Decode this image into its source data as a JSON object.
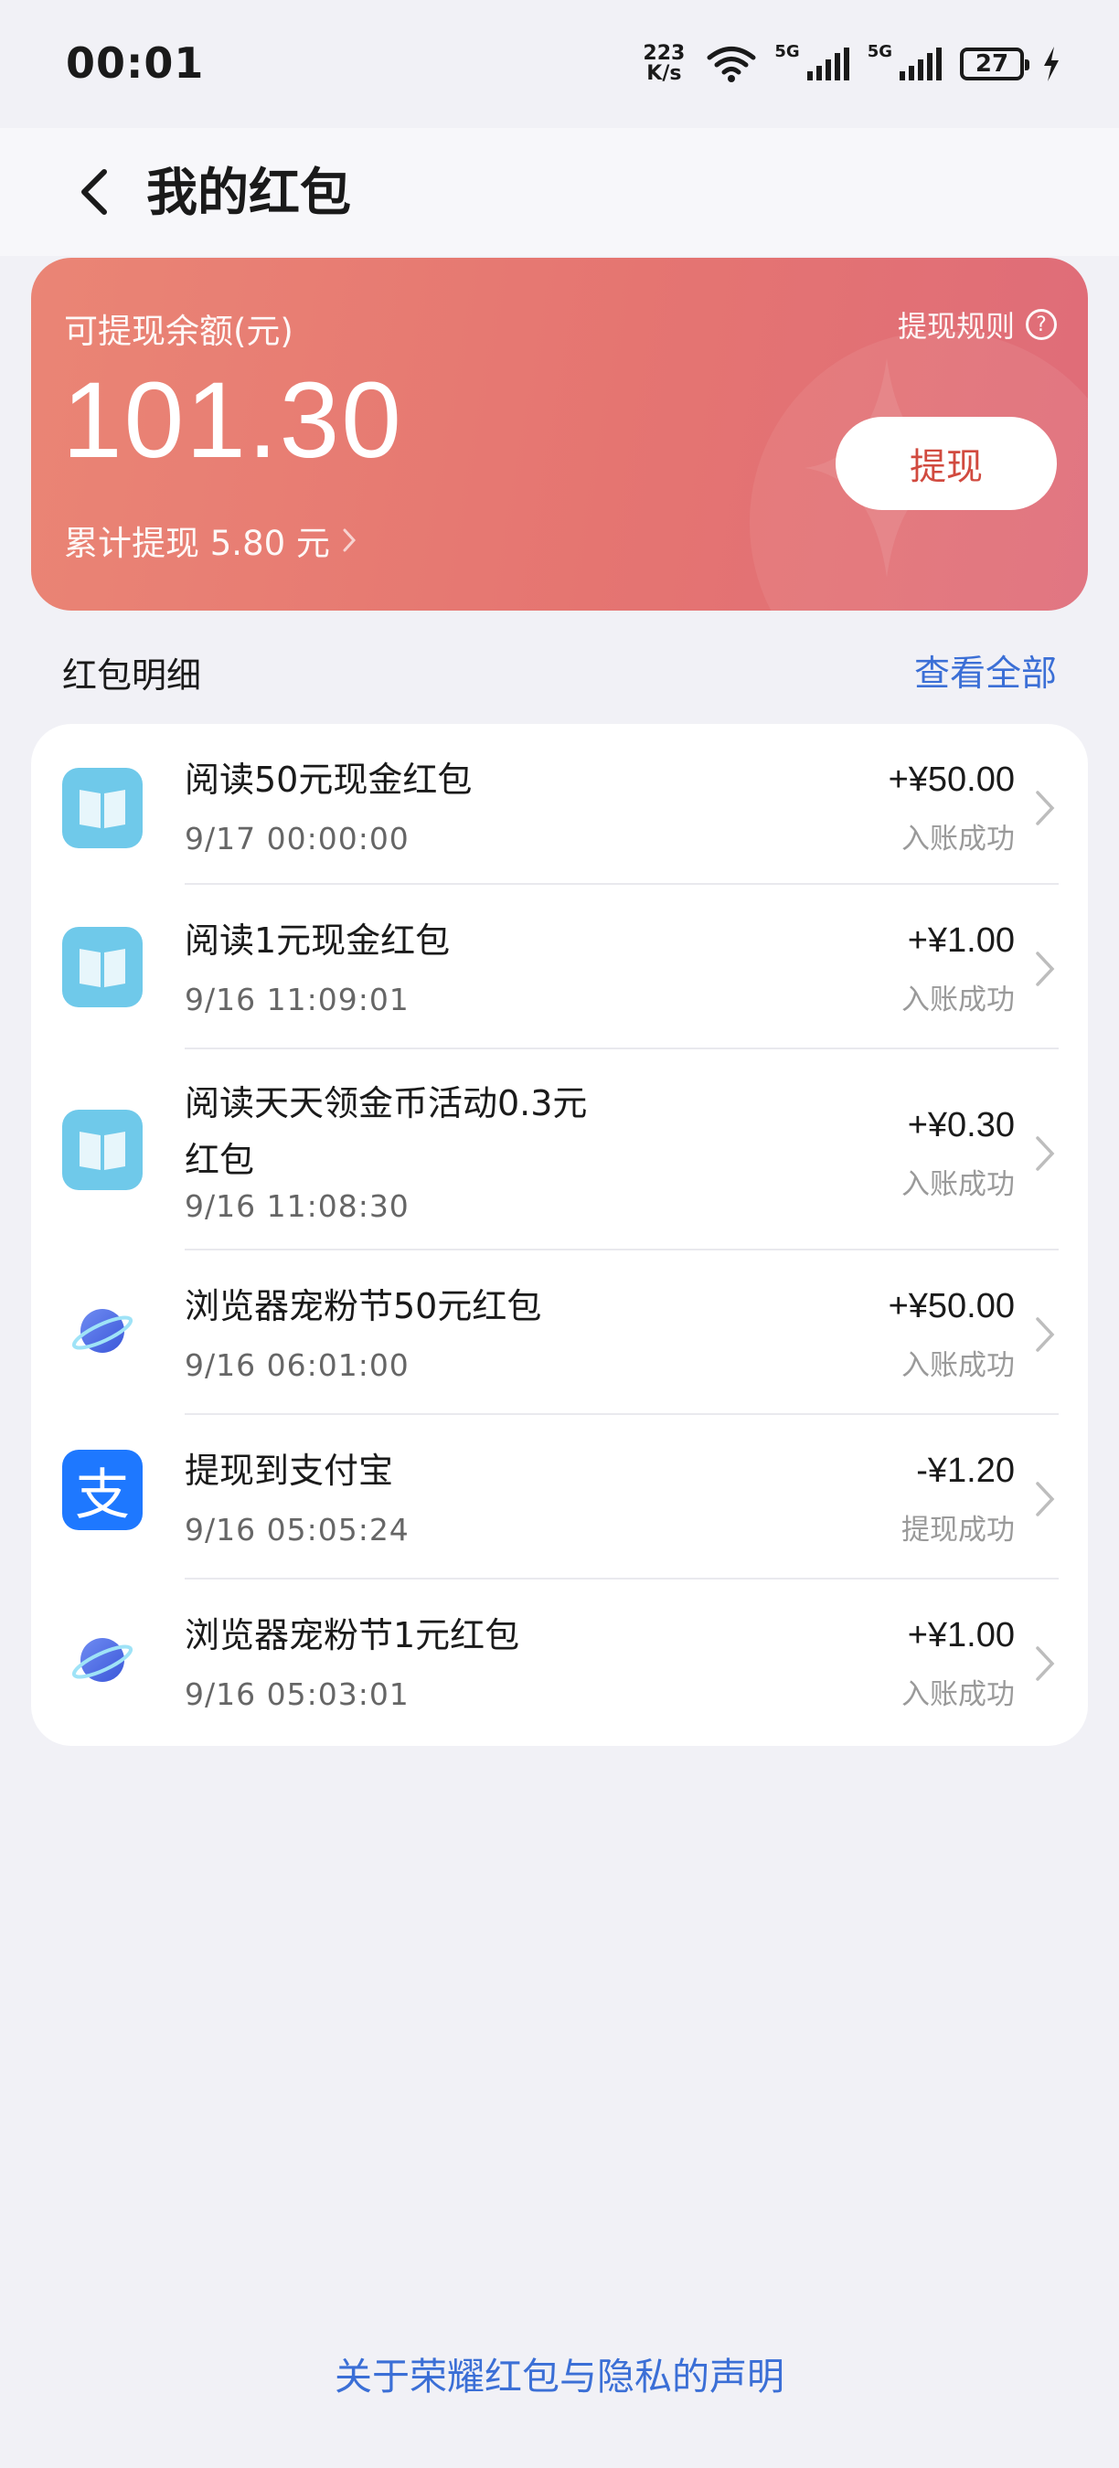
{
  "status_bar": {
    "time": "00:01",
    "speed_value": "223",
    "speed_unit": "K/s",
    "net1": "5G",
    "net2": "5G",
    "battery": "27"
  },
  "header": {
    "title": "我的红包"
  },
  "balance_card": {
    "label": "可提现余额(元)",
    "rules_label": "提现规则",
    "amount": "101.30",
    "cumulative": "累计提现 5.80 元",
    "withdraw_button": "提现"
  },
  "details": {
    "title": "红包明细",
    "view_all": "查看全部",
    "items": [
      {
        "icon": "book-icon",
        "name": "阅读50元现金红包",
        "date": "9/17 00:00:00",
        "amount": "+¥50.00",
        "status": "入账成功"
      },
      {
        "icon": "book-icon",
        "name": "阅读1元现金红包",
        "date": "9/16 11:09:01",
        "amount": "+¥1.00",
        "status": "入账成功"
      },
      {
        "icon": "book-icon",
        "name": "阅读天天领金币活动0.3元红包",
        "date": "9/16 11:08:30",
        "amount": "+¥0.30",
        "status": "入账成功"
      },
      {
        "icon": "planet-icon",
        "name": "浏览器宠粉节50元红包",
        "date": "9/16 06:01:00",
        "amount": "+¥50.00",
        "status": "入账成功"
      },
      {
        "icon": "alipay-icon",
        "name": "提现到支付宝",
        "date": "9/16 05:05:24",
        "amount": "-¥1.20",
        "status": "提现成功"
      },
      {
        "icon": "planet-icon",
        "name": "浏览器宠粉节1元红包",
        "date": "9/16 05:03:01",
        "amount": "+¥1.00",
        "status": "入账成功"
      }
    ]
  },
  "alipay_glyph": "支",
  "footer": {
    "link": "关于荣耀红包与隐私的声明"
  },
  "colors": {
    "card_start": "#ea8575",
    "card_end": "#df6c79",
    "accent": "#3b6fd6",
    "button_text": "#d14a3f"
  }
}
